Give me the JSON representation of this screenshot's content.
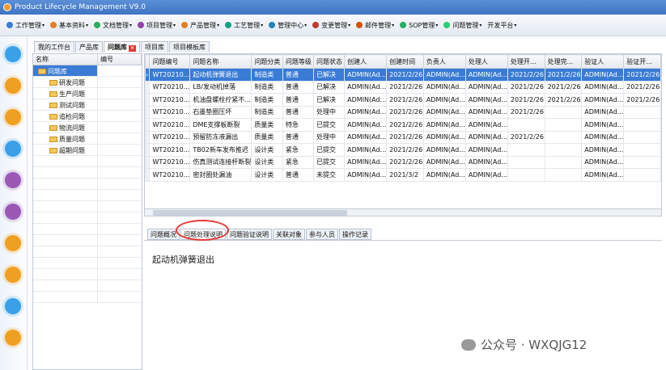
{
  "window": {
    "title": "Product Lifecycle Management V9.0"
  },
  "menubar": {
    "items": [
      {
        "label": "工作管理",
        "color": "#3a7bd5"
      },
      {
        "label": "基本资料",
        "color": "#e67e22"
      },
      {
        "label": "文档管理",
        "color": "#27ae60"
      },
      {
        "label": "项目管理",
        "color": "#8e44ad"
      },
      {
        "label": "产品管理",
        "color": "#e67e22"
      },
      {
        "label": "工艺管理",
        "color": "#16a085"
      },
      {
        "label": "管理中心",
        "color": "#2980b9"
      },
      {
        "label": "变更管理",
        "color": "#c0392b"
      },
      {
        "label": "邮件管理",
        "color": "#d35400"
      },
      {
        "label": "SOP管理",
        "color": "#27ae60"
      },
      {
        "label": "问题管理",
        "color": "#2ecc71"
      },
      {
        "label": "开发平台",
        "color": ""
      }
    ]
  },
  "tabs": [
    {
      "label": "我的工作台"
    },
    {
      "label": "产品库"
    },
    {
      "label": "问题库",
      "active": true,
      "close": "×"
    },
    {
      "label": "项目库"
    },
    {
      "label": "项目模板库"
    }
  ],
  "tree": {
    "headers": [
      "名称",
      "编号"
    ],
    "root": "问题库",
    "children": [
      "研发问题",
      "生产问题",
      "测试问题",
      "追检问题",
      "物流问题",
      "质量问题",
      "超期问题"
    ]
  },
  "grid": {
    "headers": [
      "问题编号",
      "问题名称",
      "问题分类",
      "问题等级",
      "问题状态",
      "创建人",
      "创建时间",
      "负责人",
      "处理人",
      "处理开...",
      "处理完...",
      "验证人",
      "验证开..."
    ],
    "rows": [
      [
        "WT20210...",
        "起动机弹簧退出",
        "制造类",
        "普通",
        "已解决",
        "ADMIN(Ad...",
        "2021/2/26",
        "ADMIN(Ad...",
        "ADMIN(Ad...",
        "2021/2/26",
        "2021/2/26",
        "ADMIN(Ad...",
        "2021/2/26"
      ],
      [
        "WT20210...",
        "LB/发动机掉落",
        "制造类",
        "普通",
        "已解决",
        "ADMIN(Ad...",
        "2021/2/26",
        "ADMIN(Ad...",
        "ADMIN(Ad...",
        "2021/2/26",
        "2021/2/26",
        "ADMIN(Ad...",
        "2021/2/26"
      ],
      [
        "WT20210...",
        "机油盘螺栓拧紧不...",
        "制造类",
        "普通",
        "已解决",
        "ADMIN(Ad...",
        "2021/2/26",
        "ADMIN(Ad...",
        "ADMIN(Ad...",
        "2021/2/26",
        "2021/2/26",
        "ADMIN(Ad...",
        "2021/2/26"
      ],
      [
        "WT20210...",
        "石墨垫圈压坏",
        "制造类",
        "普通",
        "处理中",
        "ADMIN(Ad...",
        "2021/2/26",
        "ADMIN(Ad...",
        "ADMIN(Ad...",
        "2021/2/26",
        "",
        "ADMIN(Ad...",
        ""
      ],
      [
        "WT20210...",
        "DME支撑板断裂",
        "质量类",
        "特急",
        "已提交",
        "ADMIN(Ad...",
        "2021/2/26",
        "ADMIN(Ad...",
        "ADMIN(Ad...",
        "",
        "",
        "ADMIN(Ad...",
        ""
      ],
      [
        "WT20210...",
        "预留防冻液漏出",
        "质量类",
        "普通",
        "处理中",
        "ADMIN(Ad...",
        "2021/2/26",
        "ADMIN(Ad...",
        "ADMIN(Ad...",
        "2021/2/26",
        "",
        "ADMIN(Ad...",
        ""
      ],
      [
        "WT20210...",
        "TB02新车发布推迟",
        "设计类",
        "紧急",
        "已提交",
        "ADMIN(Ad...",
        "2021/2/26",
        "ADMIN(Ad...",
        "ADMIN(Ad...",
        "",
        "",
        "ADMIN(Ad...",
        ""
      ],
      [
        "WT20210...",
        "伤真测试连接杆断裂",
        "设计类",
        "紧急",
        "已提交",
        "ADMIN(Ad...",
        "2021/2/26",
        "ADMIN(Ad...",
        "ADMIN(Ad...",
        "",
        "",
        "ADMIN(Ad...",
        ""
      ],
      [
        "WT20210...",
        "密封圈处漏油",
        "设计类",
        "普通",
        "未提交",
        "ADMIN(Ad...",
        "2021/3/2",
        "ADMIN(Ad...",
        "ADMIN(Ad...",
        "",
        "",
        "ADMIN(Ad...",
        ""
      ]
    ]
  },
  "detail": {
    "tabs": [
      "问题概况",
      "问题处理说明",
      "问题验证说明",
      "关联对象",
      "参与人员",
      "操作记录"
    ],
    "active": 1,
    "text": "起动机弹簧退出"
  },
  "rail": [
    "#3aa0e8",
    "#f0a020",
    "#f0a020",
    "#3aa0e8",
    "#9b59b6",
    "#9b59b6",
    "#f0a020",
    "#f0a020",
    "#3aa0e8",
    "#f0a020"
  ],
  "watermark": "公众号 · WXQJG12"
}
